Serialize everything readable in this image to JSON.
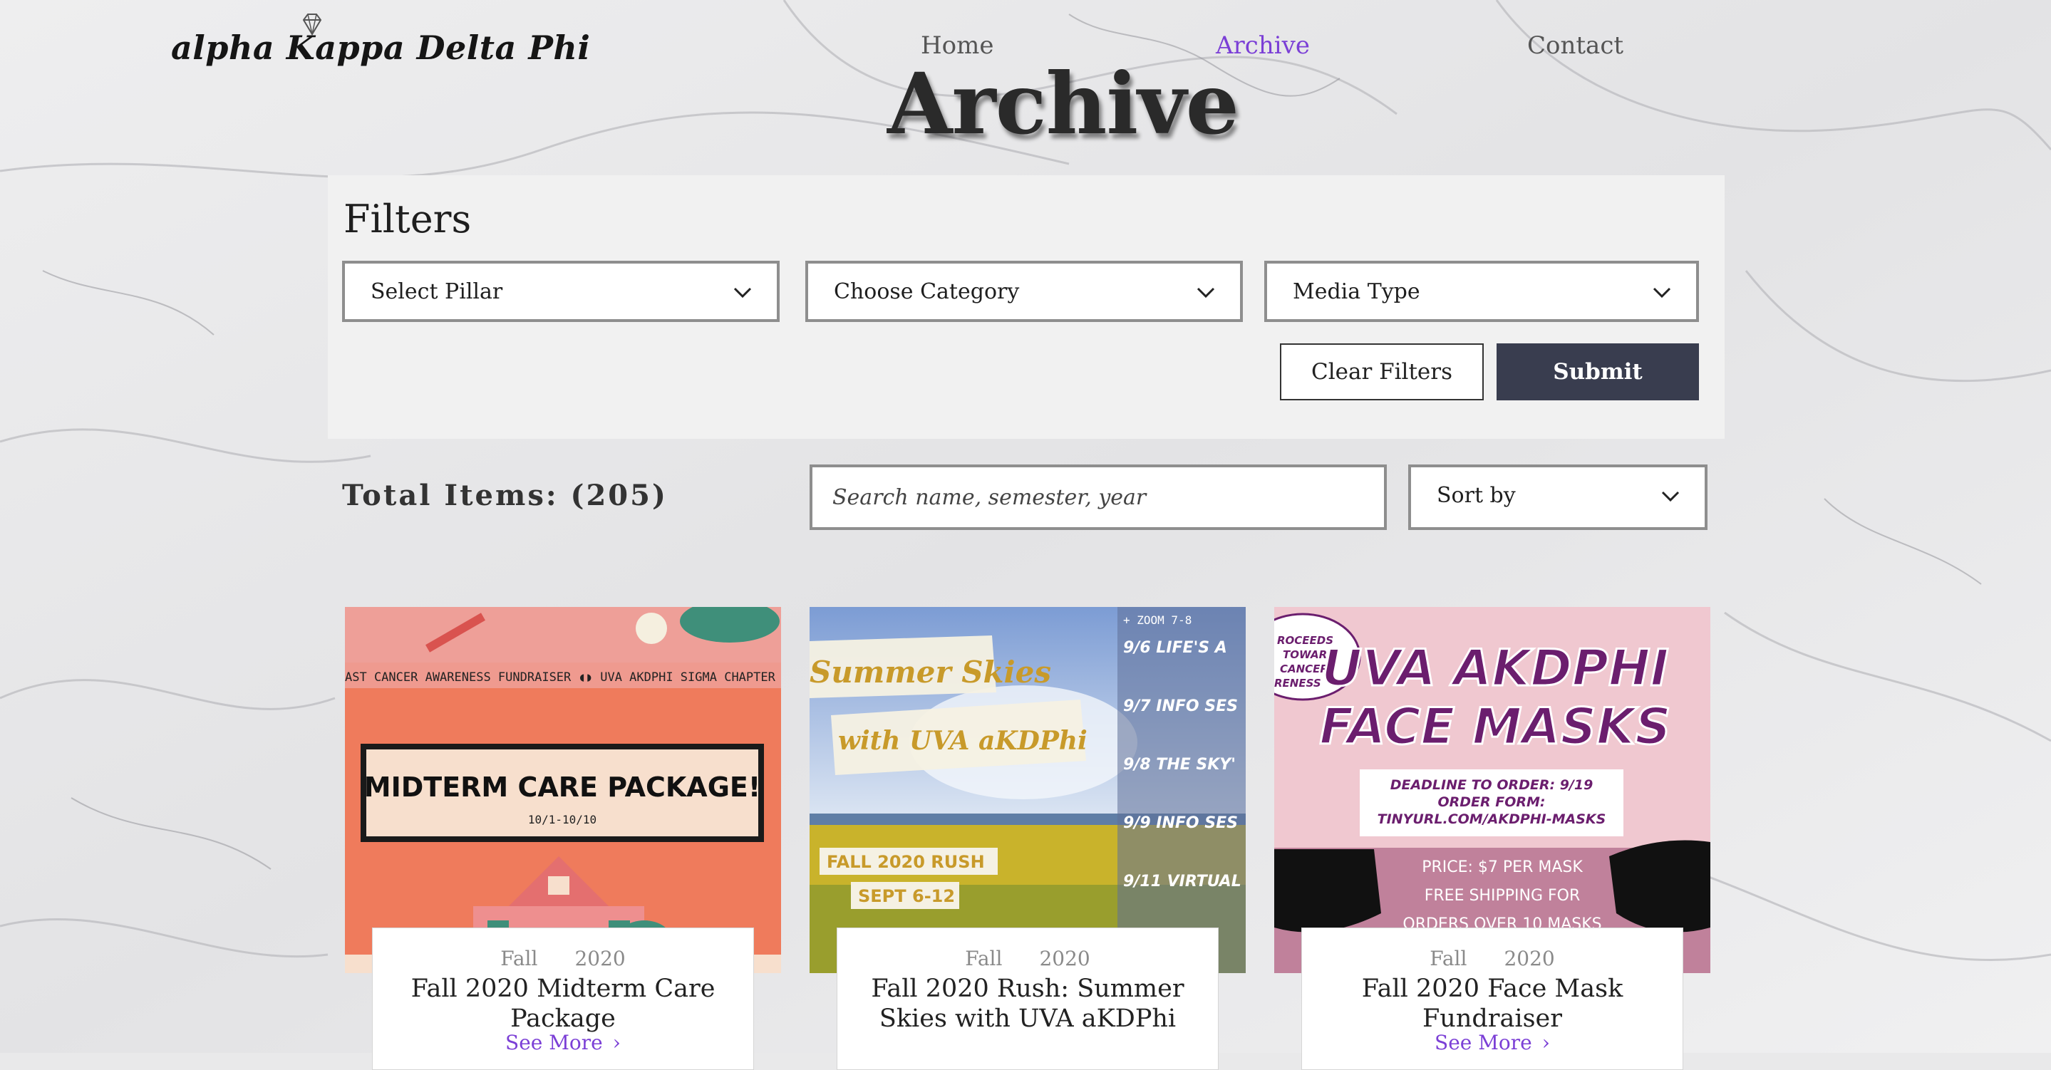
{
  "header": {
    "logo_text": "alpha Kappa Delta Phi",
    "nav": [
      {
        "label": "Home",
        "active": false
      },
      {
        "label": "Archive",
        "active": true
      },
      {
        "label": "Contact",
        "active": false
      }
    ],
    "page_title": "Archive"
  },
  "filters": {
    "title": "Filters",
    "pillar": "Select Pillar",
    "category": "Choose Category",
    "media_type": "Media Type",
    "clear_label": "Clear Filters",
    "submit_label": "Submit"
  },
  "toolbar": {
    "total_label": "Total Items: (205)",
    "search_placeholder": "Search name, semester, year",
    "sort_label": "Sort by"
  },
  "cards": [
    {
      "semester": "Fall",
      "year": "2020",
      "title": "Fall 2020 Midterm Care Package",
      "see_more": "See More",
      "image": {
        "banner": "AST CANCER AWARENESS FUNDRAISER ◖◗ UVA AKDPHI SIGMA CHAPTER",
        "headline": "MIDTERM CARE PACKAGE!",
        "dates": "10/1-10/10"
      }
    },
    {
      "semester": "Fall",
      "year": "2020",
      "title": "Fall 2020 Rush: Summer Skies with UVA aKDPhi",
      "see_more": "See More",
      "image": {
        "ribbon1": "Summer Skies",
        "ribbon2": "with UVA aKDPhi",
        "tag1": "FALL 2020 RUSH",
        "tag2": "SEPT 6-12",
        "schedule_header": "+ ZOOM 7-8",
        "schedule": [
          "9/6 LIFE'S A",
          "9/7 INFO SES",
          "9/8 THE SKY'",
          "9/9 INFO SES",
          "9/11 VIRTUAL"
        ]
      }
    },
    {
      "semester": "Fall",
      "year": "2020",
      "title": "Fall 2020 Face Mask Fundraiser",
      "see_more": "See More",
      "image": {
        "headline1": "UVA AKDPHI",
        "headline2": "FACE MASKS",
        "bubble": [
          "ROCEEDS",
          "TOWARD",
          "CANCER",
          "RENESS"
        ],
        "order_lines": [
          "DEADLINE TO ORDER: 9/19",
          "ORDER FORM:",
          "TINYURL.COM/AKDPHI-MASKS"
        ],
        "price": "PRICE: $7 PER MASK",
        "shipping": "FREE SHIPPING FOR",
        "orders": "ORDERS OVER 10 MASKS"
      }
    }
  ]
}
